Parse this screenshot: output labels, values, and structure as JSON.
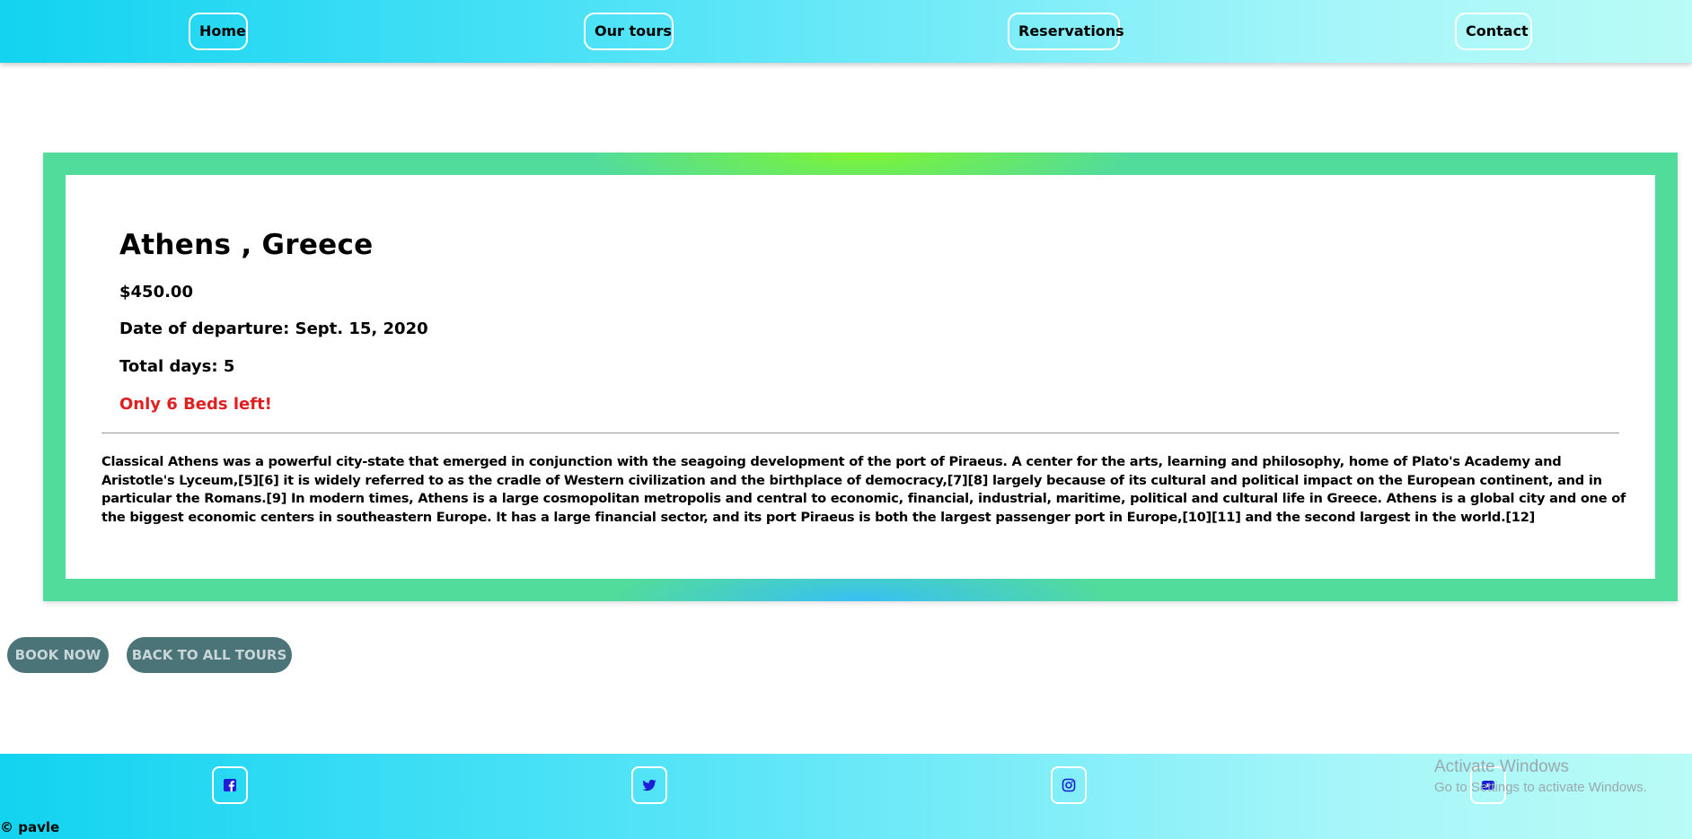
{
  "nav": {
    "items": [
      {
        "label": "Home"
      },
      {
        "label": "Our tours"
      },
      {
        "label": "Reservations"
      },
      {
        "label": "Contact"
      }
    ]
  },
  "tour": {
    "title": "Athens , Greece",
    "price": "$450.00",
    "departure": "Date of departure: Sept. 15, 2020",
    "total_days": "Total days: 5",
    "beds_left": "Only 6 Beds left!",
    "description": "Classical Athens was a powerful city-state that emerged in conjunction with the seagoing development of the port of Piraeus. A center for the arts, learning and philosophy, home of Plato's Academy and Aristotle's Lyceum,[5][6] it is widely referred to as the cradle of Western civilization and the birthplace of democracy,[7][8] largely because of its cultural and political impact on the European continent, and in particular the Romans.[9] In modern times, Athens is a large cosmopolitan metropolis and central to economic, financial, industrial, maritime, political and cultural life in Greece. Athens is a global city and one of the biggest economic centers in southeastern Europe. It has a large financial sector, and its port Piraeus is both the largest passenger port in Europe,[10][11] and the second largest in the world.[12]"
  },
  "actions": {
    "book_label": "BOOK NOW",
    "back_label": "BACK TO ALL TOURS"
  },
  "footer": {
    "social": [
      {
        "icon": "facebook-icon"
      },
      {
        "icon": "twitter-icon"
      },
      {
        "icon": "instagram-icon"
      },
      {
        "icon": "youtube-icon"
      }
    ],
    "copyright": "© pavle"
  },
  "watermark": {
    "line1": "Activate Windows",
    "line2": "Go to Settings to activate Windows."
  },
  "colors": {
    "nav_gradient_start": "#12d3f0",
    "nav_gradient_end": "#b9fbf6",
    "card_border": "#52dc9b",
    "beds_text": "#e02020",
    "action_button": "#4b7479",
    "social_icon": "#1d1dd8"
  }
}
